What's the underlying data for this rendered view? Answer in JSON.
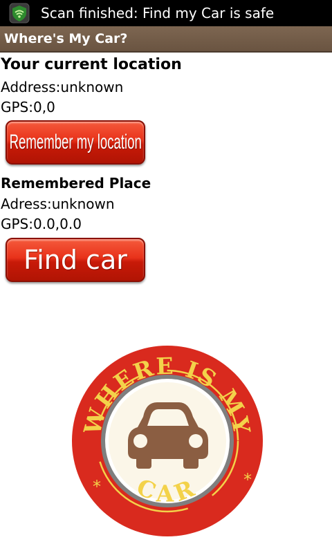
{
  "status_bar": {
    "notification_icon": "security-shield-icon",
    "text": "Scan finished: Find my Car is safe"
  },
  "app_bar": {
    "title": "Where's My Car?"
  },
  "current_location": {
    "heading": "Your current location",
    "address": "Address:unknown",
    "gps": "GPS:0,0",
    "button_label": "Remember my location"
  },
  "remembered_place": {
    "heading": "Remembered Place",
    "address": "Adress:unknown",
    "gps": "GPS:0.0,0.0",
    "button_label": "Find car"
  },
  "logo": {
    "text_top": "WHERE IS MY",
    "text_bottom": "CAR",
    "icon": "car-icon",
    "colors": {
      "ring": "#d92a1e",
      "ring_text": "#f3d24a",
      "inner_ring": "#8a8a8a",
      "center": "#fbf6e8",
      "car": "#8b5e42"
    }
  }
}
